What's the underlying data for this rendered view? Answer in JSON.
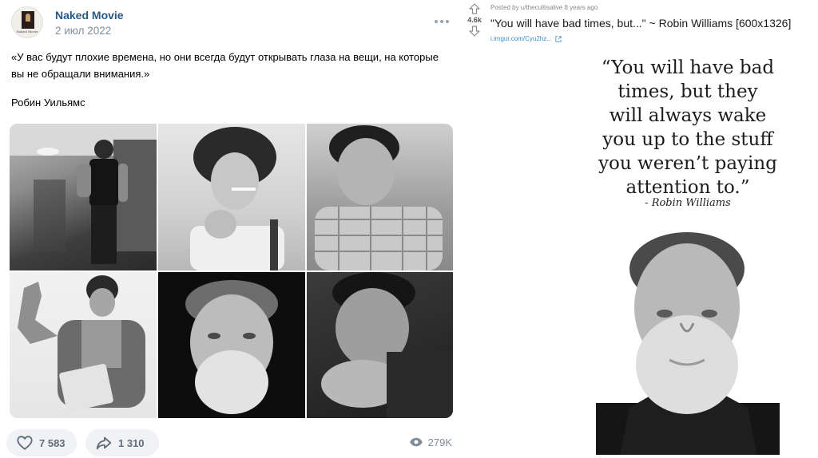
{
  "vk": {
    "author": "Naked Movie",
    "date": "2 июл 2022",
    "text": "«У вас будут плохие времена, но они всегда будут открывать глаза на вещи, на которые вы не обращали внимания.»",
    "signature": "Робин Уильямс",
    "likes": "7 583",
    "shares": "1 310",
    "views": "279K",
    "avatar_caption": "Naked Movie",
    "colors": {
      "name": "#2a5885",
      "secondary": "#818c99",
      "pill_bg": "#f0f2f5"
    }
  },
  "reddit": {
    "score": "4.6k",
    "meta": "Posted by u/thecultisalive 8 years ago",
    "title": "\"You will have bad times, but...\" ~ Robin Williams [600x1326]",
    "link": "i.imgur.com/Cyu2hz...",
    "quote_lines": [
      "“You will have bad",
      "times, but they",
      "will always wake",
      "you up to the stuff",
      "you weren’t paying",
      "attention to.”"
    ],
    "quote_signature": "- Robin Williams",
    "colors": {
      "link": "#3a8fd0",
      "meta": "#888888"
    }
  },
  "icons": {
    "more": "more-horizontal-icon",
    "like": "heart-icon",
    "share": "share-arrow-icon",
    "views": "eye-icon",
    "upvote": "upvote-arrow-icon",
    "downvote": "downvote-arrow-icon",
    "external": "external-link-icon"
  }
}
